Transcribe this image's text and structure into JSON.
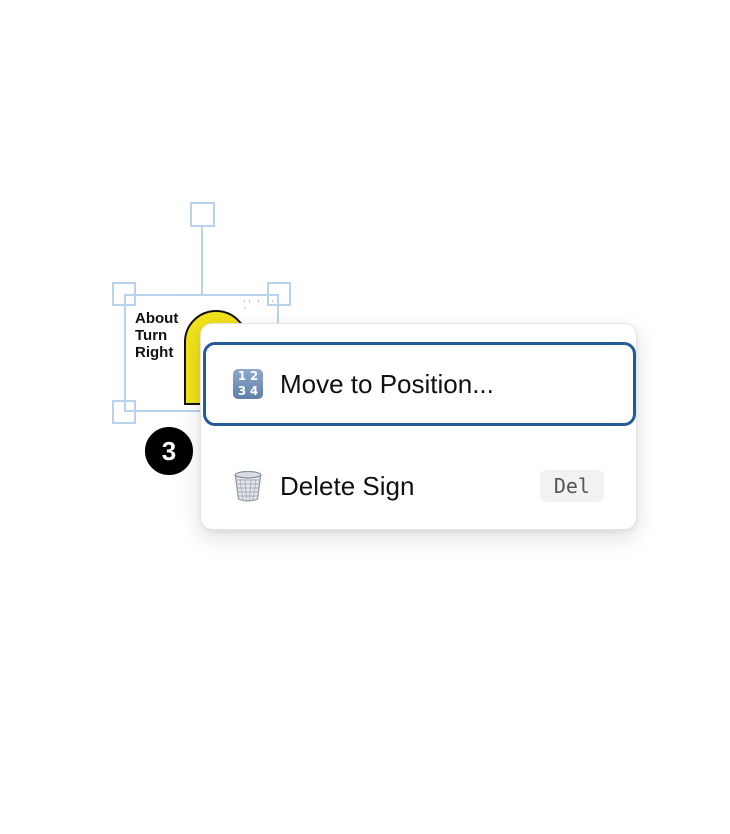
{
  "sign": {
    "text_lines": [
      "About",
      "Turn",
      "Right"
    ],
    "graphic_color": "#f1e21a",
    "small_marks": "·· · ·· ·"
  },
  "badge": {
    "number": "3"
  },
  "context_menu": {
    "items": [
      {
        "label": "Move to Position...",
        "icon": "numbers-icon",
        "shortcut": "",
        "highlighted": true
      },
      {
        "label": "Delete Sign",
        "icon": "wastebasket-icon",
        "shortcut": "Del",
        "highlighted": false
      }
    ],
    "highlight_color": "#245a96"
  },
  "selection": {
    "handle_color": "#b9d3ef"
  },
  "numbers_icon_digits": [
    "1",
    "2",
    "3",
    "4"
  ]
}
